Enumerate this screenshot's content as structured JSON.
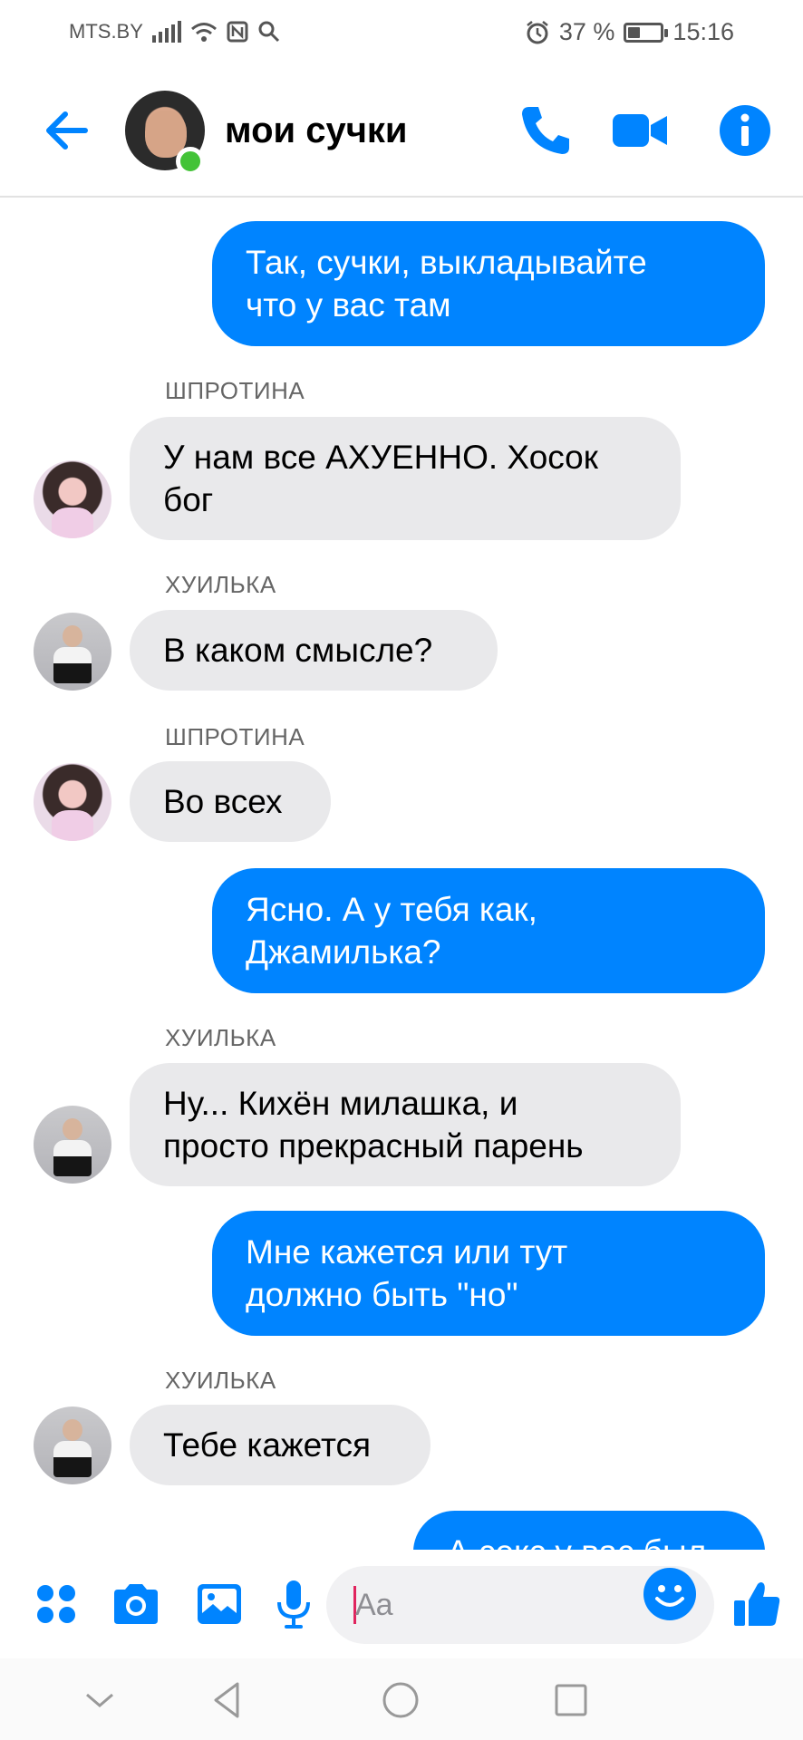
{
  "status_bar": {
    "carrier": "MTS.BY",
    "alarm_icon": "alarm-icon",
    "battery_text": "37 %",
    "battery_level": 0.37,
    "time": "15:16"
  },
  "header": {
    "title": "мои сучки",
    "online": true
  },
  "messages": [
    {
      "type": "outgoing",
      "lines": [
        "Так, сучки, выкладывайте",
        "что у вас там"
      ]
    },
    {
      "type": "incoming",
      "sender": "ШПРОТИНА",
      "lines": [
        "У нам все АХУЕННО. Хосок",
        "бог"
      ]
    },
    {
      "type": "incoming",
      "sender": "ХУИЛЬКА",
      "lines": [
        "В каком смысле?"
      ]
    },
    {
      "type": "incoming",
      "sender": "ШПРОТИНА",
      "lines": [
        "Во всех"
      ]
    },
    {
      "type": "outgoing",
      "lines": [
        "Ясно. А у тебя как,",
        "Джамилька?"
      ]
    },
    {
      "type": "incoming",
      "sender": "ХУИЛЬКА",
      "lines": [
        "Ну... Кихён милашка, и",
        "просто прекрасный парень"
      ]
    },
    {
      "type": "outgoing",
      "lines": [
        "Мне кажется или тут",
        "должно быть  \"но\""
      ]
    },
    {
      "type": "incoming",
      "sender": "ХУИЛЬКА",
      "lines": [
        "Тебе кажется"
      ]
    },
    {
      "type": "outgoing",
      "lines": [
        "А секс у вас был"
      ]
    }
  ],
  "composer": {
    "placeholder": "Aa"
  },
  "colors": {
    "accent": "#0084ff",
    "incoming_bubble": "#e9e9eb",
    "online": "#43c337"
  }
}
